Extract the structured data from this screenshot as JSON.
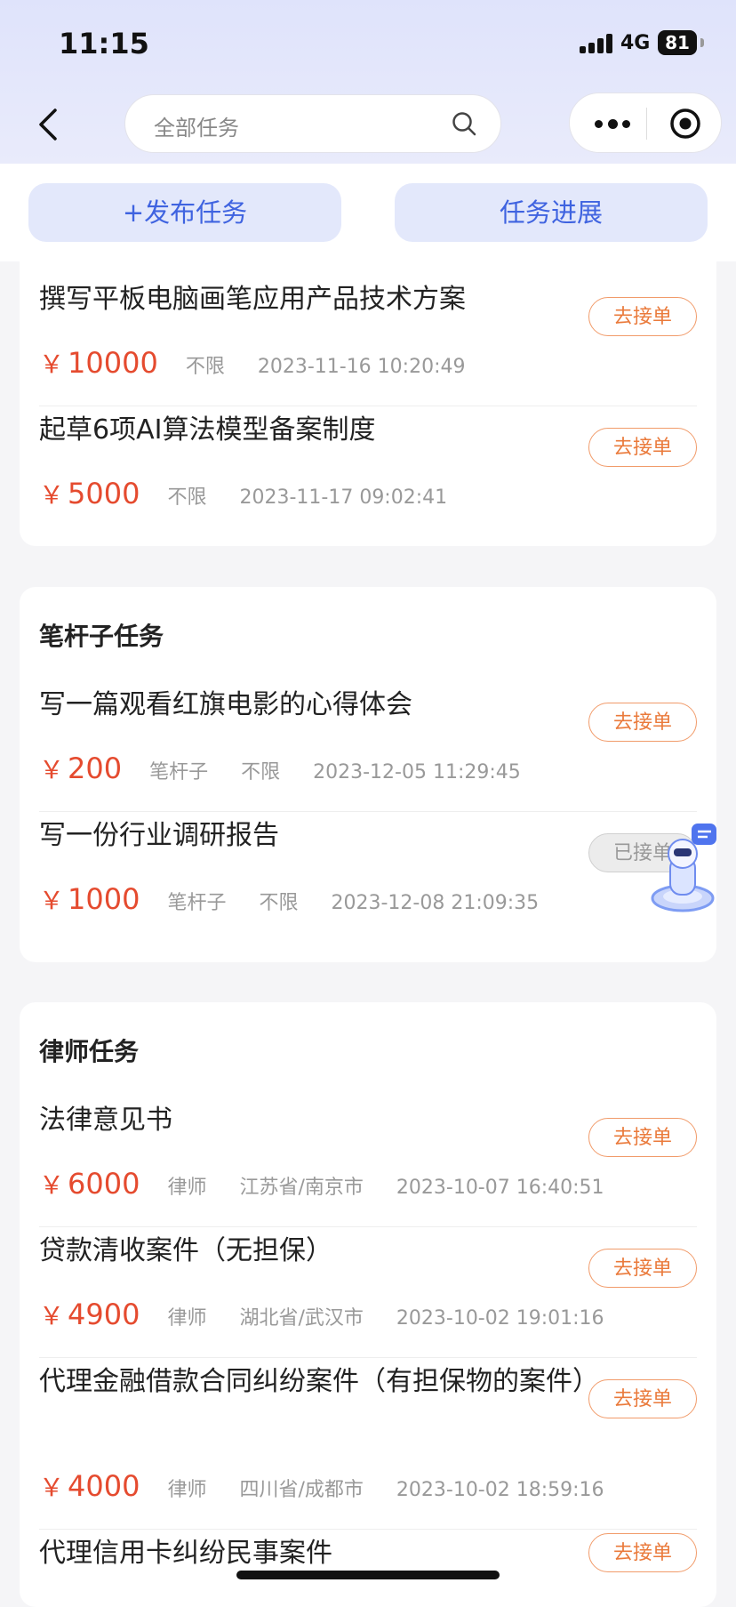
{
  "status": {
    "time": "11:15",
    "network": "4G",
    "battery": "81"
  },
  "header": {
    "search_placeholder": "全部任务"
  },
  "actions": {
    "publish": "+发布任务",
    "progress": "任务进展"
  },
  "partial_section": {
    "tasks": [
      {
        "title": "撰写平板电脑画笔应用产品技术方案",
        "price": "10000",
        "tags": [
          "不限"
        ],
        "date": "2023-11-16 10:20:49",
        "button": "去接单"
      },
      {
        "title": "起草6项AI算法模型备案制度",
        "price": "5000",
        "tags": [
          "不限"
        ],
        "date": "2023-11-17 09:02:41",
        "button": "去接单"
      }
    ]
  },
  "bigan_section": {
    "title": "笔杆子任务",
    "tasks": [
      {
        "title": "写一篇观看红旗电影的心得体会",
        "price": "200",
        "tags": [
          "笔杆子",
          "不限"
        ],
        "date": "2023-12-05 11:29:45",
        "button": "去接单"
      },
      {
        "title": "写一份行业调研报告",
        "price": "1000",
        "tags": [
          "笔杆子",
          "不限"
        ],
        "date": "2023-12-08 21:09:35",
        "button": "已接单"
      }
    ]
  },
  "lawyer_section": {
    "title": "律师任务",
    "tasks": [
      {
        "title": "法律意见书",
        "price": "6000",
        "tags": [
          "律师",
          "江苏省/南京市"
        ],
        "date": "2023-10-07 16:40:51",
        "button": "去接单"
      },
      {
        "title": "贷款清收案件（无担保）",
        "price": "4900",
        "tags": [
          "律师",
          "湖北省/武汉市"
        ],
        "date": "2023-10-02 19:01:16",
        "button": "去接单"
      },
      {
        "title": "代理金融借款合同纠纷案件（有担保物的案件）",
        "price": "4000",
        "tags": [
          "律师",
          "四川省/成都市"
        ],
        "date": "2023-10-02 18:59:16",
        "button": "去接单"
      },
      {
        "title": "代理信用卡纠纷民事案件",
        "button": "去接单"
      }
    ]
  },
  "currency_symbol": "￥",
  "colors": {
    "accent_blue": "#3f63e0",
    "price_red": "#e54b2f",
    "pill_orange": "#ea7a3b"
  }
}
